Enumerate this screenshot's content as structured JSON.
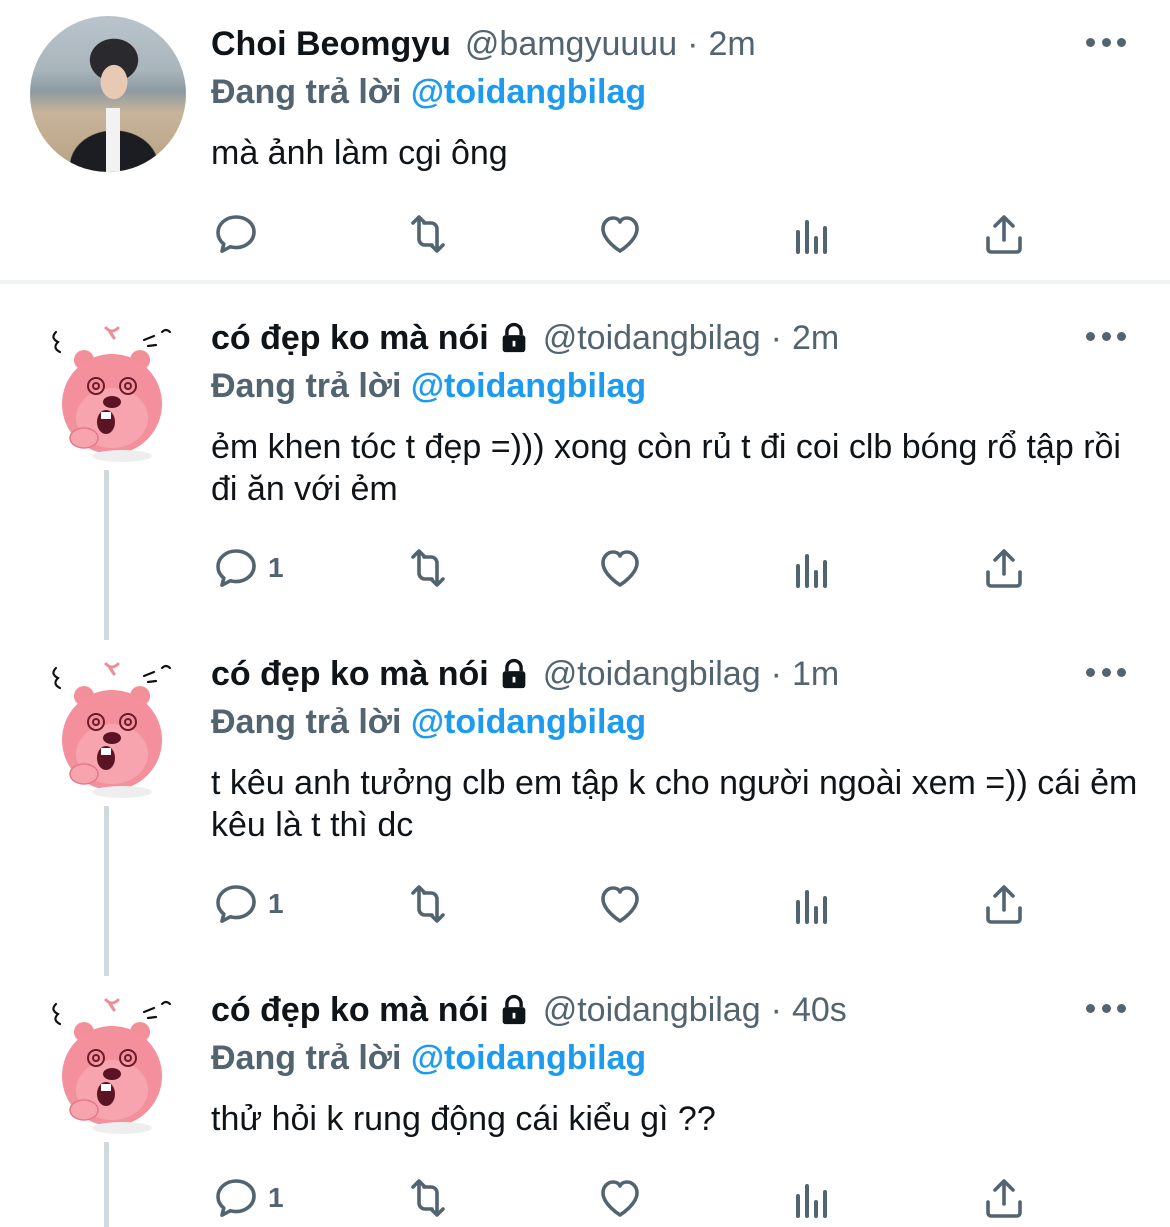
{
  "tweets": [
    {
      "name": "Choi Beomgyu",
      "handle": "@bamgyuuuu",
      "separator": "·",
      "time": "2m",
      "reply_prefix": "Đang trả lời",
      "reply_to": "@toidangbilag",
      "text": "mà ảnh làm cgi ông",
      "reply_count": "",
      "avatar": "photo-avatar",
      "locked": false
    },
    {
      "name": "có đẹp ko mà nói",
      "handle": "@toidangbilag",
      "separator": "·",
      "time": "2m",
      "reply_prefix": "Đang trả lời",
      "reply_to": "@toidangbilag",
      "text": "ẻm khen tóc t đẹp =))) xong còn rủ t đi coi clb bóng rổ tập rồi đi ăn với ẻm",
      "reply_count": "1",
      "avatar": "pink-beaver-avatar",
      "locked": true
    },
    {
      "name": "có đẹp ko mà nói",
      "handle": "@toidangbilag",
      "separator": "·",
      "time": "1m",
      "reply_prefix": "Đang trả lời",
      "reply_to": "@toidangbilag",
      "text": "t kêu anh tưởng clb em tập k cho người ngoài xem =)) cái ẻm kêu là t thì dc",
      "reply_count": "1",
      "avatar": "pink-beaver-avatar",
      "locked": true
    },
    {
      "name": "có đẹp ko mà nói",
      "handle": "@toidangbilag",
      "separator": "·",
      "time": "40s",
      "reply_prefix": "Đang trả lời",
      "reply_to": "@toidangbilag",
      "text": "thử hỏi k rung động cái kiểu gì ??",
      "reply_count": "1",
      "avatar": "pink-beaver-avatar",
      "locked": true
    }
  ],
  "icons": {
    "reply": "reply-icon",
    "retweet": "retweet-icon",
    "like": "heart-icon",
    "views": "bar-chart-icon",
    "share": "share-icon",
    "more": "more-icon",
    "lock": "lock-icon"
  },
  "colors": {
    "link": "#1d9bf0",
    "secondary_text": "#536471",
    "primary_text": "#0f1419",
    "thread_line": "#cfd9de",
    "avatar_beaver": "#f08a96"
  }
}
